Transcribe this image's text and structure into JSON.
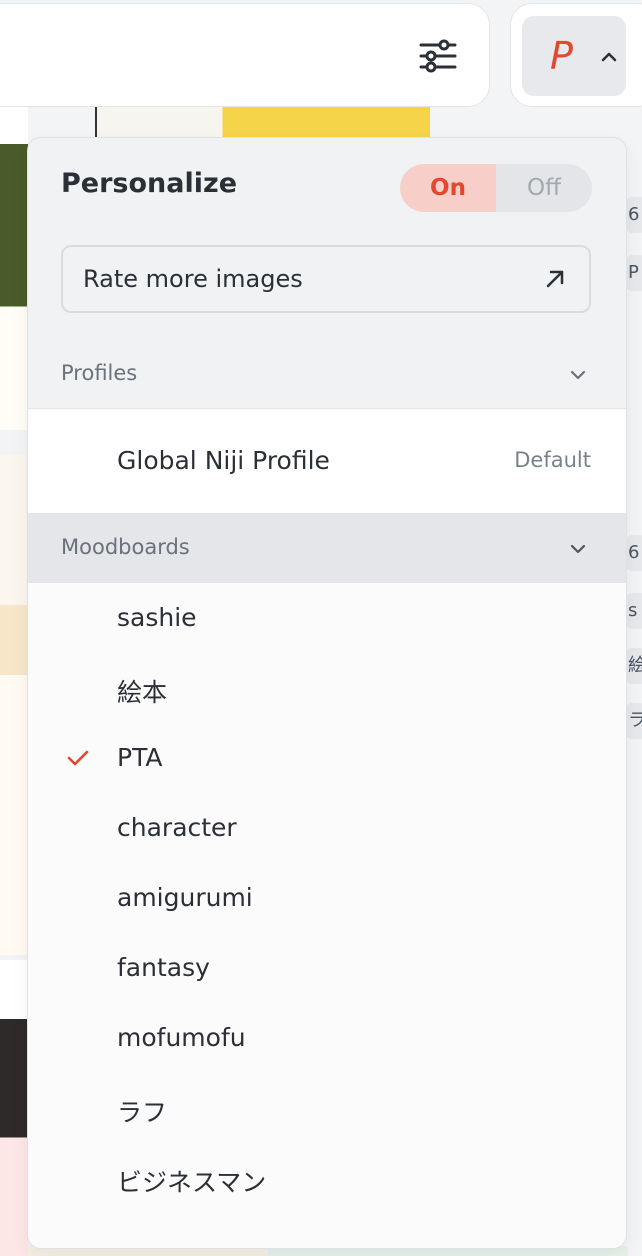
{
  "colors": {
    "accent": "#e3472f",
    "toggle_on_bg": "#f8cfc8",
    "panel_bg": "#fbfbfc",
    "section_bg": "#f1f2f4",
    "moodboards_header_bg": "#e5e6e9"
  },
  "topbar": {
    "filter_icon": "sliders-icon",
    "profile_button": {
      "letter": "P",
      "icon": "chevron-up-icon"
    }
  },
  "personalize": {
    "title": "Personalize",
    "toggle": {
      "on_label": "On",
      "off_label": "Off",
      "selected": "On"
    },
    "rate_button": {
      "label": "Rate more images",
      "icon": "arrow-up-right-icon"
    }
  },
  "profiles": {
    "header": "Profiles",
    "header_icon": "chevron-down-icon",
    "items": [
      {
        "name": "Global Niji Profile",
        "badge": "Default"
      }
    ]
  },
  "moodboards": {
    "header": "Moodboards",
    "header_icon": "chevron-down-icon",
    "items": [
      {
        "label": "sashie",
        "selected": false
      },
      {
        "label": "絵本",
        "selected": false
      },
      {
        "label": "PTA",
        "selected": true
      },
      {
        "label": "character",
        "selected": false
      },
      {
        "label": "amigurumi",
        "selected": false
      },
      {
        "label": "fantasy",
        "selected": false
      },
      {
        "label": "mofumofu",
        "selected": false
      },
      {
        "label": "ラフ",
        "selected": false
      },
      {
        "label": "ビジネスマン",
        "selected": false
      }
    ]
  },
  "background_edge_cards": [
    {
      "text": "6"
    },
    {
      "text": "P"
    },
    {
      "text": "6"
    },
    {
      "text": "s"
    },
    {
      "text": "絵"
    },
    {
      "text": "ラ"
    }
  ]
}
